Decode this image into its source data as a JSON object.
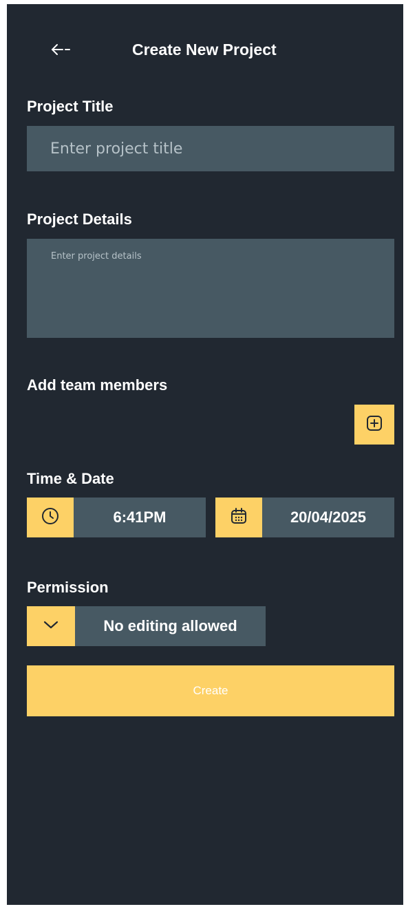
{
  "header": {
    "title": "Create New Project",
    "back_icon": "arrow-left-icon"
  },
  "form": {
    "project_title": {
      "label": "Project Title",
      "placeholder": "Enter project title",
      "value": ""
    },
    "project_details": {
      "label": "Project Details",
      "placeholder": "Enter project details",
      "value": ""
    },
    "team_members": {
      "label": "Add team members",
      "add_icon": "plus-square-icon"
    },
    "time_date": {
      "label": "Time & Date",
      "time": "6:41PM",
      "time_icon": "clock-icon",
      "date": "20/04/2025",
      "date_icon": "calendar-icon"
    },
    "permission": {
      "label": "Permission",
      "selected": "No editing allowed",
      "dropdown_icon": "chevron-down-icon"
    },
    "create_label": "Create"
  },
  "colors": {
    "background": "#212831",
    "field": "#475963",
    "accent": "#fdd166",
    "text": "#ffffff"
  }
}
